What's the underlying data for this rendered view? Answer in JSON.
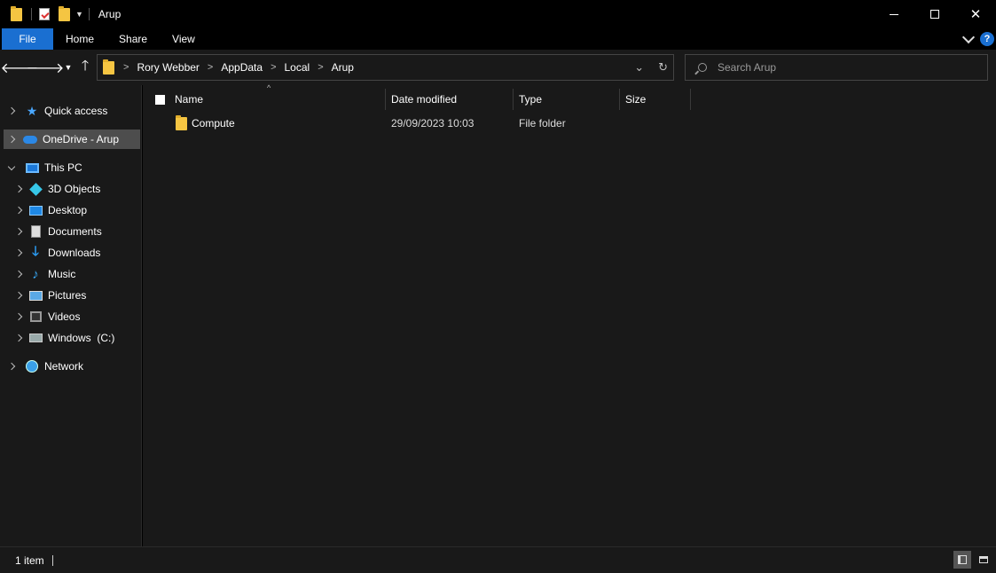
{
  "window": {
    "title": "Arup"
  },
  "ribbon": {
    "tabs": [
      {
        "label": "File"
      },
      {
        "label": "Home"
      },
      {
        "label": "Share"
      },
      {
        "label": "View"
      }
    ]
  },
  "address": {
    "crumbs": [
      {
        "label": "Rory Webber"
      },
      {
        "label": "AppData"
      },
      {
        "label": "Local"
      },
      {
        "label": "Arup"
      }
    ],
    "separator": ">"
  },
  "search": {
    "placeholder": "Search Arup"
  },
  "navpane": {
    "items": [
      {
        "label": "Quick access",
        "icon": "star-icon"
      },
      {
        "label": "OneDrive - Arup",
        "icon": "onedrive-cloud-icon",
        "selected": true
      },
      {
        "label": "This PC",
        "icon": "pc-monitor-icon",
        "expanded": true
      },
      {
        "label": "3D Objects",
        "icon": "3d-objects-icon"
      },
      {
        "label": "Desktop",
        "icon": "desktop-icon"
      },
      {
        "label": "Documents",
        "icon": "documents-icon"
      },
      {
        "label": "Downloads",
        "icon": "downloads-icon"
      },
      {
        "label": "Music",
        "icon": "music-icon"
      },
      {
        "label": "Pictures",
        "icon": "pictures-icon"
      },
      {
        "label": "Videos",
        "icon": "videos-icon"
      },
      {
        "label": "Windows  (C:)",
        "icon": "drive-icon"
      },
      {
        "label": "Network",
        "icon": "network-icon"
      }
    ]
  },
  "filelist": {
    "columns": [
      {
        "label": "Name"
      },
      {
        "label": "Date modified"
      },
      {
        "label": "Type"
      },
      {
        "label": "Size"
      }
    ],
    "rows": [
      {
        "name": "Compute",
        "date": "29/09/2023 10:03",
        "type": "File folder",
        "size": ""
      }
    ]
  },
  "status": {
    "count": "1 item"
  },
  "colors": {
    "accent": "#1a6fd1",
    "background": "#191919",
    "selection": "#4d4d4d",
    "folder": "#f5c542"
  }
}
